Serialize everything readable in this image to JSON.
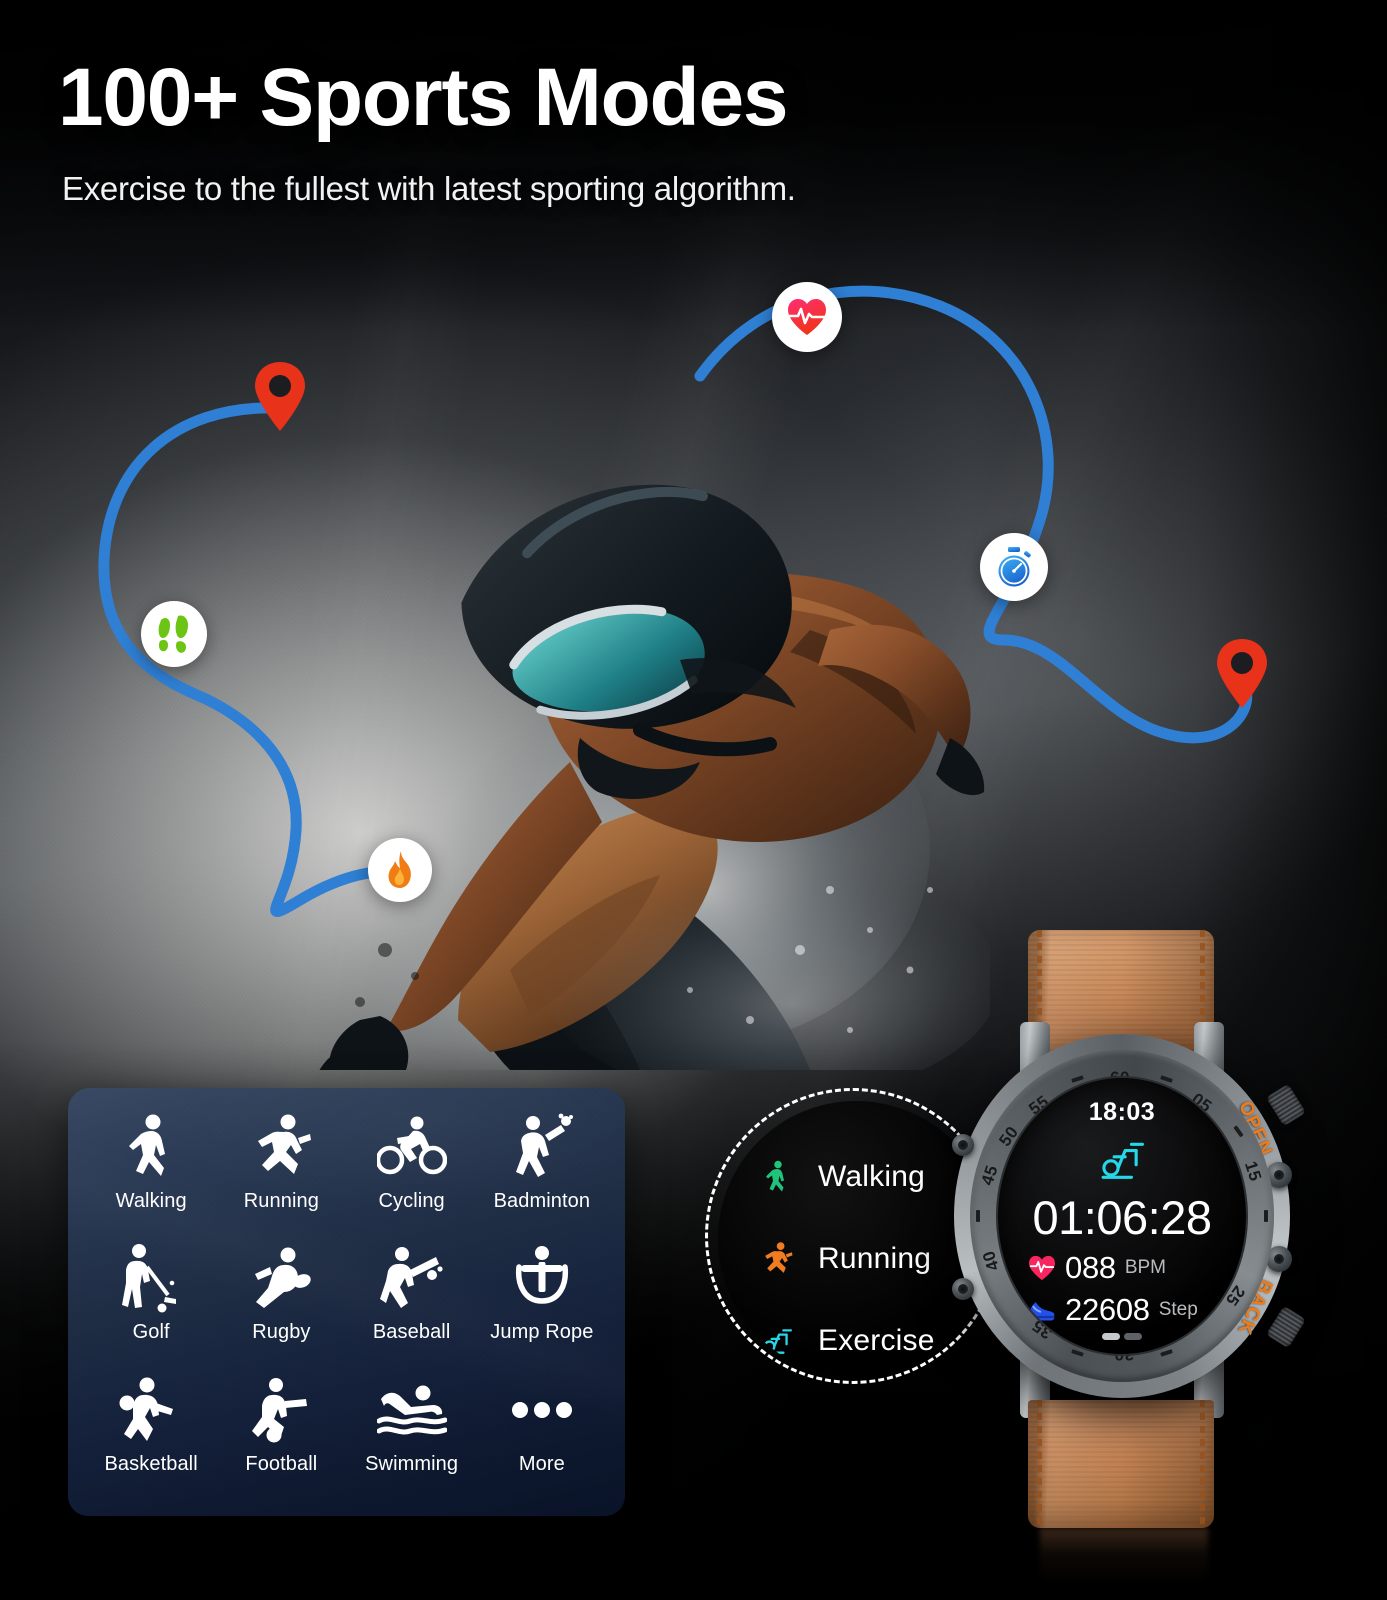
{
  "header": {
    "headline": "100+ Sports Modes",
    "subhead": "Exercise to the fullest with latest sporting algorithm."
  },
  "colors": {
    "path_blue": "#2f7fd4",
    "pin_red": "#e8321a",
    "heart_pink": "#f9255f",
    "foot_green": "#6cc514",
    "stopwatch_blue": "#2f9ae8",
    "flame_orange": "#f07c14",
    "panel_top": "#3a4a64",
    "panel_bottom": "#0a1328",
    "band_brown": "#c98a58",
    "side_text_orange": "#ef7b18",
    "menu_walking": "#1fc47a",
    "menu_running": "#f07b20",
    "menu_exercise": "#25d8e8"
  },
  "float_icons": [
    {
      "name": "heart-rate-icon",
      "label": "Heart Rate"
    },
    {
      "name": "footprints-icon",
      "label": "Steps"
    },
    {
      "name": "stopwatch-icon",
      "label": "Stopwatch"
    },
    {
      "name": "flame-icon",
      "label": "Calories"
    },
    {
      "name": "map-pin-icon",
      "label": "GPS Location"
    },
    {
      "name": "map-pin-icon",
      "label": "GPS Location"
    }
  ],
  "sports_grid": {
    "items": [
      {
        "label": "Walking",
        "icon": "walking-icon"
      },
      {
        "label": "Running",
        "icon": "running-icon"
      },
      {
        "label": "Cycling",
        "icon": "cycling-icon"
      },
      {
        "label": "Badminton",
        "icon": "badminton-icon"
      },
      {
        "label": "Golf",
        "icon": "golf-icon"
      },
      {
        "label": "Rugby",
        "icon": "rugby-icon"
      },
      {
        "label": "Baseball",
        "icon": "baseball-icon"
      },
      {
        "label": "Jump Rope",
        "icon": "jump-rope-icon"
      },
      {
        "label": "Basketball",
        "icon": "basketball-icon"
      },
      {
        "label": "Football",
        "icon": "football-icon"
      },
      {
        "label": "Swimming",
        "icon": "swimming-icon"
      },
      {
        "label": "More",
        "icon": "more-ellipsis-icon"
      }
    ]
  },
  "callout_menu": {
    "items": [
      {
        "label": "Walking",
        "icon": "walking-icon",
        "color": "#1fc47a"
      },
      {
        "label": "Running",
        "icon": "running-icon",
        "color": "#f07b20"
      },
      {
        "label": "Exercise",
        "icon": "exercise-bike-icon",
        "color": "#25d8e8"
      }
    ]
  },
  "watch": {
    "dial": {
      "time": "18:03",
      "sport_icon": "exercise-bike-icon",
      "timer": "01:06:28",
      "heart_rate_value": "088",
      "heart_rate_unit": "BPM",
      "steps_value": "22608",
      "steps_unit": "Step"
    },
    "bezel_numbers": [
      "60",
      "05",
      "15",
      "25",
      "30",
      "35",
      "40",
      "45",
      "50",
      "55"
    ],
    "side_labels": {
      "open": "OPEN",
      "back": "BACK"
    }
  }
}
